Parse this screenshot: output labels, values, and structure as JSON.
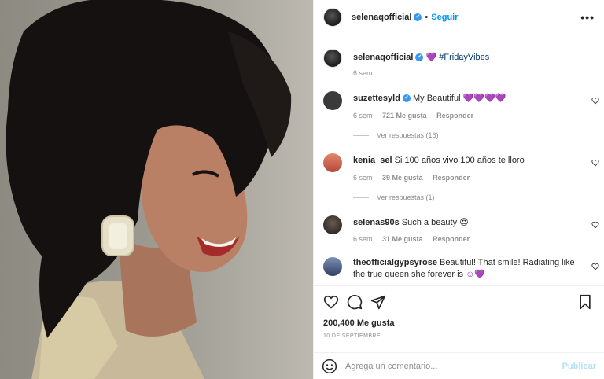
{
  "header": {
    "username": "selenaqofficial",
    "verified_mark": "✔",
    "separator": "•",
    "follow_label": "Seguir",
    "more_icon": "more-horizontal-icon"
  },
  "caption": {
    "username": "selenaqofficial",
    "verified_mark": "✔",
    "emoji": "💜",
    "hashtag": "#FridayVibes",
    "time": "6 sem"
  },
  "comments": [
    {
      "username": "suzettesyld",
      "verified_mark": "✔",
      "text": "My Beautiful",
      "emoji": "💜💜💜💜",
      "time": "6 sem",
      "likes": "721 Me gusta",
      "reply": "Responder",
      "view_replies": "Ver respuestas (16)",
      "avatar_color": "#3a3a3a"
    },
    {
      "username": "kenia_sel",
      "text": "Si 100 años vivo 100 años te lloro",
      "time": "6 sem",
      "likes": "39 Me gusta",
      "reply": "Responder",
      "view_replies": "Ver respuestas (1)",
      "avatar_color": "#d06a55"
    },
    {
      "username": "selenas90s",
      "text": "Such a beauty",
      "emoji": "😍",
      "time": "6 sem",
      "likes": "31 Me gusta",
      "reply": "Responder",
      "avatar_color": "#2b2b2b"
    },
    {
      "username": "theofficialgypsyrose",
      "text": "Beautiful! That smile! Radiating like the true queen she forever is",
      "emoji": "☺💜",
      "avatar_color": "#4a5f86"
    }
  ],
  "actions": {
    "like_icon": "heart-icon",
    "comment_icon": "comment-icon",
    "share_icon": "share-icon",
    "save_icon": "bookmark-icon"
  },
  "likes_count": "200,400 Me gusta",
  "date": "10 DE SEPTIEMBRE",
  "add_comment": {
    "placeholder": "Agrega un comentario...",
    "publish_label": "Publicar",
    "emoji_icon": "smiley-icon"
  },
  "colors": {
    "accent": "#0095f6",
    "verified": "#3897f0",
    "muted": "#8e8e8e",
    "publish_disabled": "#b2dffc"
  }
}
